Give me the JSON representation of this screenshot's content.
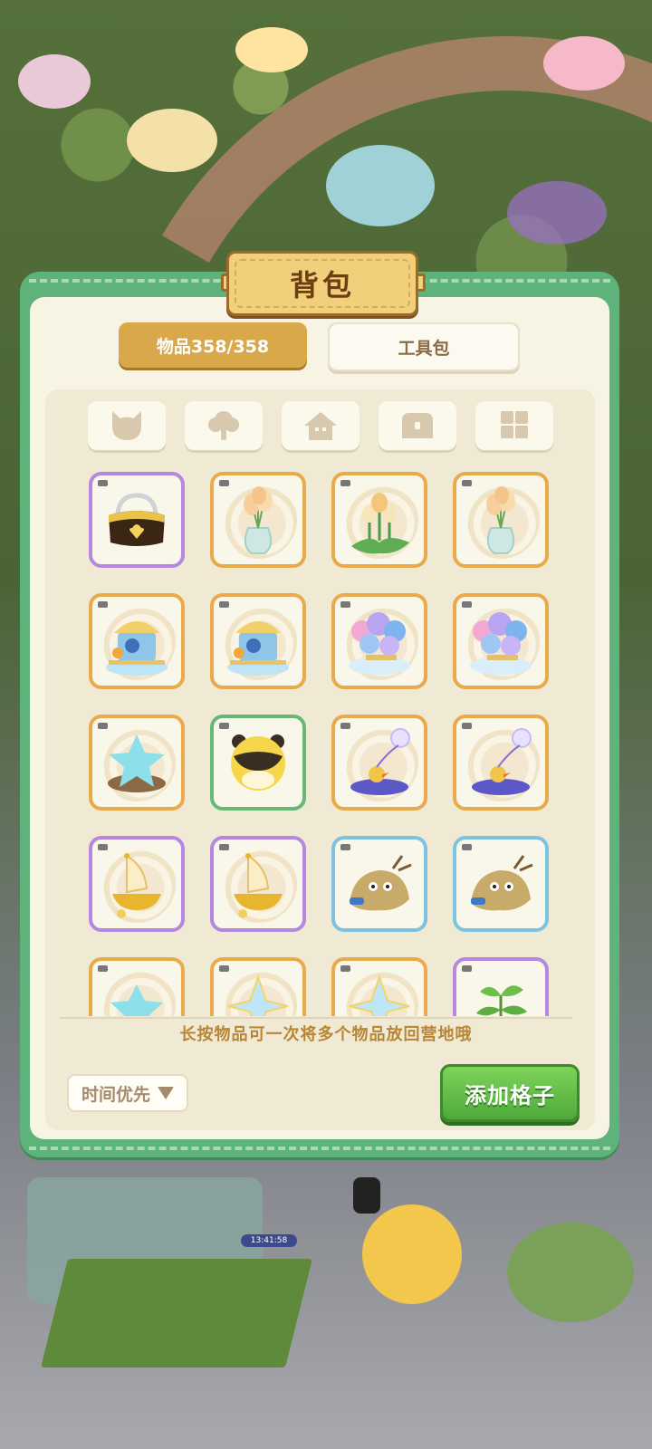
{
  "panel": {
    "title": "背包",
    "tabs": [
      {
        "label": "物品358/358",
        "active": true
      },
      {
        "label": "工具包",
        "active": false
      }
    ],
    "categories": [
      {
        "icon": "cat-icon"
      },
      {
        "icon": "tree-icon"
      },
      {
        "icon": "house-icon"
      },
      {
        "icon": "treasure-chest-icon"
      },
      {
        "icon": "grid-icon"
      }
    ],
    "items": [
      {
        "icon": "handbag-icon",
        "rarity": "purple"
      },
      {
        "icon": "flower-vase-icon",
        "rarity": "orange"
      },
      {
        "icon": "flower-plant-icon",
        "rarity": "orange"
      },
      {
        "icon": "flower-vase-icon",
        "rarity": "orange"
      },
      {
        "icon": "carousel-cart-icon",
        "rarity": "orange"
      },
      {
        "icon": "carousel-cart-icon",
        "rarity": "orange"
      },
      {
        "icon": "hydrangea-bench-icon",
        "rarity": "orange"
      },
      {
        "icon": "hydrangea-bench-icon",
        "rarity": "orange"
      },
      {
        "icon": "star-stone-icon",
        "rarity": "orange"
      },
      {
        "icon": "bear-ball-icon",
        "rarity": "green"
      },
      {
        "icon": "bubble-duck-icon",
        "rarity": "orange"
      },
      {
        "icon": "bubble-duck-icon",
        "rarity": "orange"
      },
      {
        "icon": "golden-sailboat-icon",
        "rarity": "purple"
      },
      {
        "icon": "golden-sailboat-icon",
        "rarity": "purple"
      },
      {
        "icon": "rock-pile-icon",
        "rarity": "blue"
      },
      {
        "icon": "rock-pile-icon",
        "rarity": "blue"
      },
      {
        "icon": "star-stone-icon",
        "rarity": "orange"
      },
      {
        "icon": "crystal-star-icon",
        "rarity": "orange"
      },
      {
        "icon": "crystal-star-icon",
        "rarity": "orange"
      },
      {
        "icon": "leafy-plant-icon",
        "rarity": "purple"
      }
    ],
    "hint": "长按物品可一次将多个物品放回营地哦",
    "sort_label": "时间优先",
    "add_button": "添加格子"
  },
  "background": {
    "clock": "13:41:58"
  }
}
